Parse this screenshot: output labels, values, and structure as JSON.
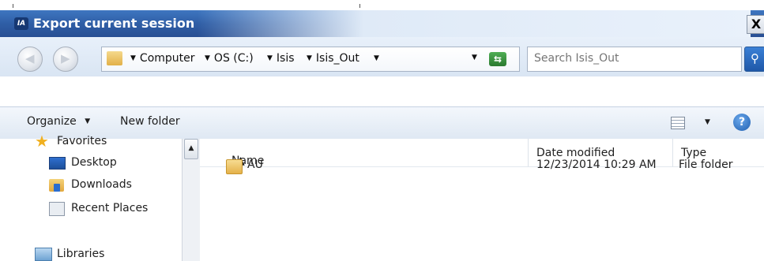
{
  "window": {
    "title": "Export current session",
    "app_icon_text": "IA",
    "close_glyph": "X"
  },
  "address_bar": {
    "breadcrumbs": [
      "Computer",
      "OS (C:)",
      "Isis",
      "Isis_Out"
    ],
    "search_placeholder": "Search Isis_Out"
  },
  "toolbar": {
    "organize_label": "Organize",
    "new_folder_label": "New folder"
  },
  "nav_pane": {
    "items": [
      {
        "label": "Favorites",
        "icon": "star-icon"
      },
      {
        "label": "Desktop",
        "icon": "desktop-icon"
      },
      {
        "label": "Downloads",
        "icon": "downloads-icon"
      },
      {
        "label": "Recent Places",
        "icon": "recent-places-icon"
      },
      {
        "label": "Libraries",
        "icon": "libraries-icon"
      }
    ]
  },
  "file_list": {
    "columns": [
      "Name",
      "Date modified",
      "Type"
    ],
    "rows": [
      {
        "name": "AU",
        "date_modified": "12/23/2014 10:29 AM",
        "type": "File folder"
      }
    ]
  },
  "colors": {
    "titlebar": "#2f5ea6",
    "address_bg": "#dfe9f5",
    "folder": "#e4b14a"
  }
}
